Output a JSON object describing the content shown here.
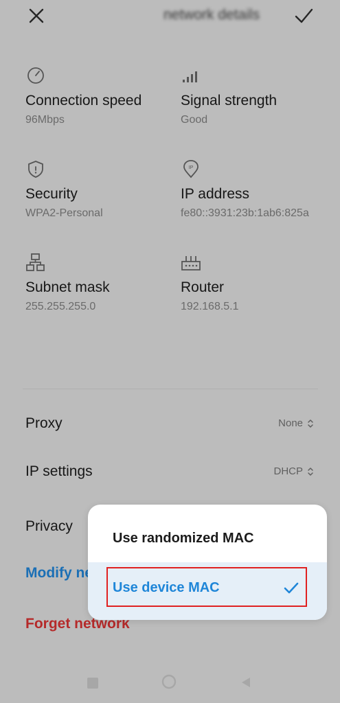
{
  "header": {
    "title": "network details"
  },
  "details": [
    {
      "label": "Connection speed",
      "value": "96Mbps",
      "icon": "speedometer-icon"
    },
    {
      "label": "Signal strength",
      "value": "Good",
      "icon": "signal-icon"
    },
    {
      "label": "Security",
      "value": "WPA2-Personal",
      "icon": "shield-icon"
    },
    {
      "label": "IP address",
      "value": "fe80::3931:23b:1ab6:825a",
      "icon": "ip-pin-icon"
    },
    {
      "label": "Subnet mask",
      "value": "255.255.255.0",
      "icon": "network-tree-icon"
    },
    {
      "label": "Router",
      "value": "192.168.5.1",
      "icon": "router-icon"
    }
  ],
  "settings": {
    "proxy": {
      "label": "Proxy",
      "value": "None"
    },
    "ip_settings": {
      "label": "IP settings",
      "value": "DHCP"
    },
    "privacy": {
      "label": "Privacy"
    },
    "modify": {
      "label": "Modify network"
    },
    "forget": {
      "label": "Forget network"
    }
  },
  "popup": {
    "options": [
      {
        "label": "Use randomized MAC",
        "selected": false
      },
      {
        "label": "Use device MAC",
        "selected": true
      }
    ]
  },
  "colors": {
    "accent": "#1f86d8",
    "danger": "#d62828",
    "highlight_border": "#e02020"
  }
}
